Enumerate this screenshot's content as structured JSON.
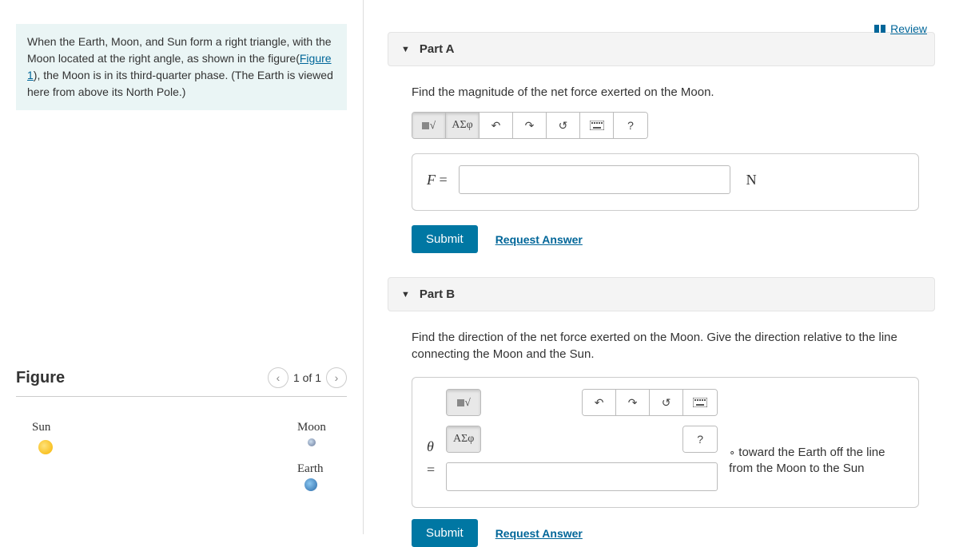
{
  "review_label": "Review",
  "problem": {
    "pre": "When the Earth, Moon, and Sun form a right triangle, with the Moon located at the right angle, as shown in the figure(",
    "figlink": "Figure 1",
    "post": "), the Moon is in its third-quarter phase. (The Earth is viewed here from above its North Pole.)"
  },
  "figure": {
    "title": "Figure",
    "pager": "1 of 1",
    "sun": "Sun",
    "moon": "Moon",
    "earth": "Earth"
  },
  "partA": {
    "title": "Part A",
    "prompt": "Find the magnitude of the net force exerted on the Moon.",
    "lhs": "F",
    "eq": "=",
    "unit": "N",
    "submit": "Submit",
    "request": "Request Answer",
    "greek": "ΑΣφ",
    "help": "?"
  },
  "partB": {
    "title": "Part B",
    "prompt": "Find the direction of the net force exerted on the Moon. Give the direction relative to the line connecting the Moon and the Sun.",
    "lhs_theta": "θ",
    "eq": "=",
    "unit_pre": "∘",
    "unit_text": "toward the Earth off the line from the Moon to the Sun",
    "submit": "Submit",
    "request": "Request Answer",
    "greek": "ΑΣφ",
    "help": "?"
  }
}
